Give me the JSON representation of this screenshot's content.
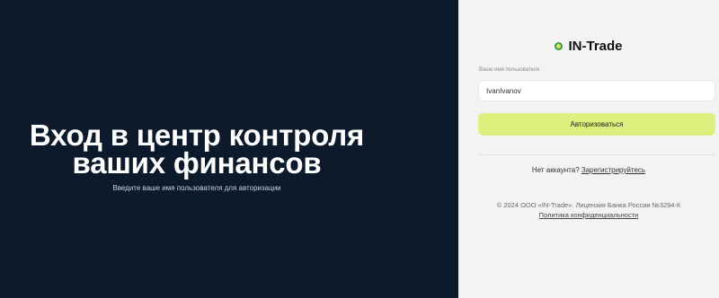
{
  "hero": {
    "title_line1": "Вход в центр контроля",
    "title_line2": "ваших финансов",
    "subtitle": "Введите ваше имя пользователя для авторизации"
  },
  "brand": {
    "name": "IN-Trade",
    "logo_icon": "brand-dot-icon",
    "logo_colors": [
      "#3a9b3a",
      "#d8ec6c"
    ]
  },
  "login_form": {
    "username_label": "Ваше имя пользователя",
    "username_value": "IvanIvanov",
    "submit_label": "Авторизоваться"
  },
  "signup": {
    "prompt": "Нет аккаунта?",
    "link": "Зарегистрируйтесь"
  },
  "footer": {
    "copyright": "© 2024 ООО «IN-Trade». Лицензия Банка России №3294-К",
    "privacy_link": "Политика конфиденциальности"
  },
  "colors": {
    "left_bg": "#0d1a2b",
    "right_bg": "#f3f3f3",
    "accent": "#dfef7e"
  }
}
